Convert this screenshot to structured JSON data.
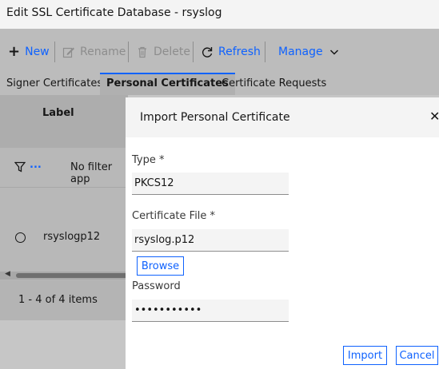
{
  "window": {
    "title": "Edit SSL Certificate Database - rsyslog"
  },
  "toolbar": {
    "new_label": "New",
    "rename_label": "Rename",
    "delete_label": "Delete",
    "refresh_label": "Refresh",
    "manage_label": "Manage"
  },
  "tabs": [
    {
      "label": "Signer Certificates",
      "active": false
    },
    {
      "label": "Personal Certificates",
      "active": true
    },
    {
      "label": "Certificate Requests",
      "active": false
    }
  ],
  "table": {
    "column_label": "Label",
    "filter_text": "No filter app",
    "rows": [
      {
        "label": "rsyslogp12"
      }
    ],
    "pagination": "1 - 4 of 4 items"
  },
  "dialog": {
    "title": "Import Personal Certificate",
    "type_label": "Type *",
    "type_value": "PKCS12",
    "file_label": "Certificate File *",
    "file_value": "rsyslog.p12",
    "browse_label": "Browse",
    "password_label": "Password",
    "password_value": "•••••••••••",
    "import_label": "Import",
    "cancel_label": "Cancel"
  },
  "colors": {
    "accent": "#0f62fe",
    "overlay": "#c6c6c6",
    "disabled": "#8d8d8d"
  }
}
